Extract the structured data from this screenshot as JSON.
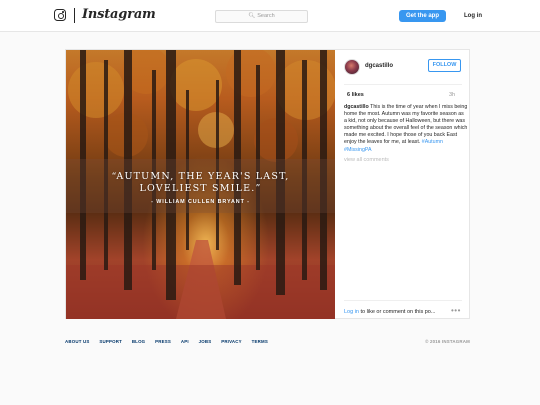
{
  "header": {
    "brand": "Instagram",
    "search_placeholder": "Search",
    "get_app_label": "Get the app",
    "login_label": "Log in"
  },
  "post": {
    "username": "dgcastillo",
    "follow_label": "FOLLOW",
    "likes": "6 likes",
    "time_ago": "3h",
    "caption_user": "dgcastillo",
    "caption_text": "This is the time of year when I miss being home the most. Autumn was my favorite season as a kid, not only because of Halloween, but there was something about the overall feel of the season which made me excited. I hope those of you back East enjoy the leaves for me, at least.",
    "hashtags": "#Autumn #MissingPA",
    "view_all_comments": "view all comments",
    "login_link": "Log in",
    "comment_prompt": "to like or comment on this po...",
    "more_label": "•••",
    "image": {
      "quote_line1": "“AUTUMN, THE YEAR'S LAST,",
      "quote_line2": "LOVELIEST SMILE.”",
      "quote_author": "- WILLIAM CULLEN BRYANT -"
    }
  },
  "footer": {
    "links": [
      "ABOUT US",
      "SUPPORT",
      "BLOG",
      "PRESS",
      "API",
      "JOBS",
      "PRIVACY",
      "TERMS"
    ],
    "copyright": "© 2016 INSTAGRAM"
  },
  "colors": {
    "accent": "#3897f0",
    "footer_link": "#003569",
    "background": "#fafafa"
  }
}
